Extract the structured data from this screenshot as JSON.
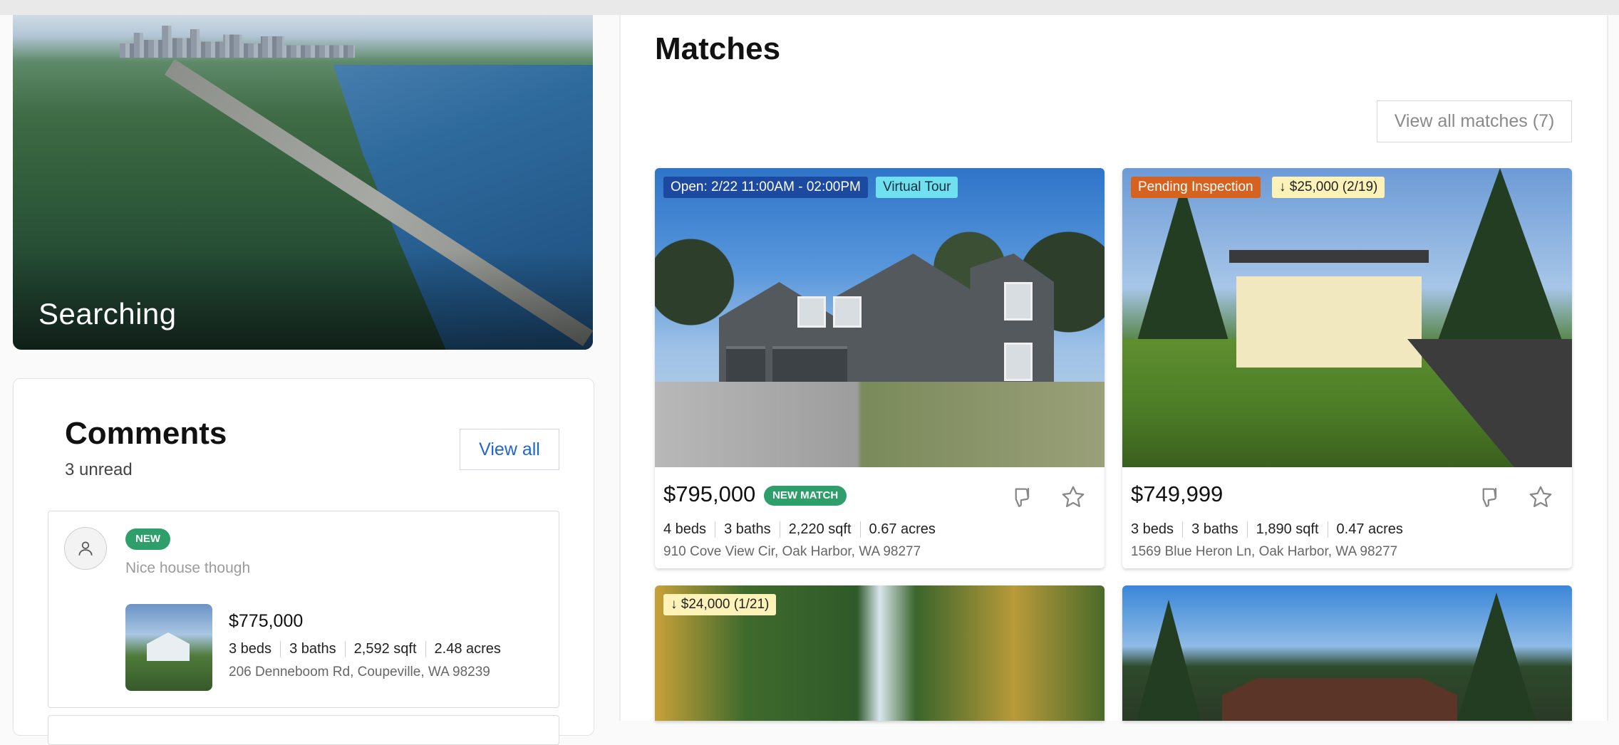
{
  "hero": {
    "title": "Searching"
  },
  "comments": {
    "title": "Comments",
    "unread": "3 unread",
    "view_all": "View all",
    "items": [
      {
        "badge": "NEW",
        "text": "Nice house though",
        "price": "$775,000",
        "beds": "3 beds",
        "baths": "3 baths",
        "sqft": "2,592 sqft",
        "acres": "2.48 acres",
        "address": "206 Denneboom Rd, Coupeville, WA 98239"
      }
    ]
  },
  "matches": {
    "title": "Matches",
    "view_all": "View all matches (7)",
    "cards": [
      {
        "tags": [
          "Open: 2/22 11:00AM - 02:00PM",
          "Virtual Tour"
        ],
        "price": "$795,000",
        "badge": "NEW MATCH",
        "beds": "4 beds",
        "baths": "3 baths",
        "sqft": "2,220 sqft",
        "acres": "0.67 acres",
        "address": "910 Cove View Cir, Oak Harbor, WA 98277"
      },
      {
        "tags": [
          "Pending Inspection",
          "$25,000 (2/19)"
        ],
        "price": "$749,999",
        "badge": "",
        "beds": "3 beds",
        "baths": "3 baths",
        "sqft": "1,890 sqft",
        "acres": "0.47 acres",
        "address": "1569 Blue Heron Ln, Oak Harbor, WA 98277"
      },
      {
        "tags": [
          "$24,000 (1/21)"
        ]
      },
      {
        "tags": []
      }
    ]
  },
  "colors": {
    "accent_blue": "#1f67c9",
    "new_green": "#2e9f6b",
    "open_tag": "#1c4aa0",
    "tour_tag": "#6fe0ee",
    "pending_tag": "#d6621f",
    "price_drop_tag": "#fdf2b8"
  },
  "icons": [
    "user-icon",
    "thumbs-down-icon",
    "star-icon",
    "arrow-down-icon"
  ]
}
